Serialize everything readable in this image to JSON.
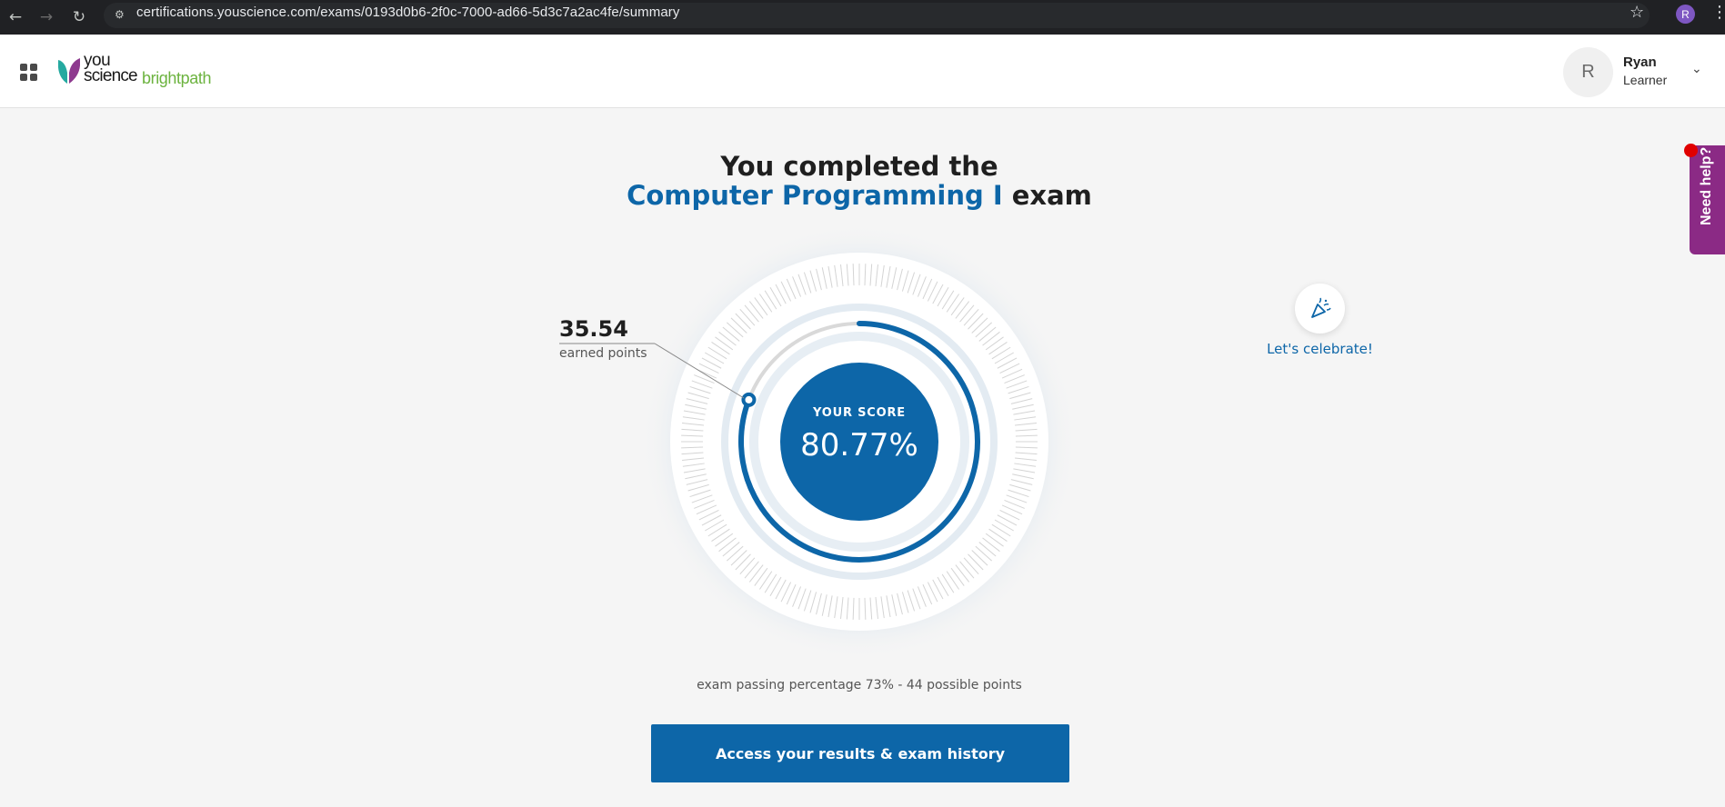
{
  "browser": {
    "url": "certifications.youscience.com/exams/0193d0b6-2f0c-7000-ad66-5d3c7a2ac4fe/summary",
    "back_icon": "back-arrow-icon",
    "forward_icon": "forward-arrow-icon",
    "reload_icon": "reload-icon",
    "profile_initial": "R"
  },
  "header": {
    "logo_you": "you",
    "logo_science": "science",
    "logo_brightpath": "brightpath",
    "user_initial": "R",
    "user_name": "Ryan",
    "user_role": "Learner"
  },
  "summary": {
    "title_line1": "You completed the",
    "exam_name": "Computer Programming I",
    "title_suffix": " exam",
    "earned_points": "35.54",
    "earned_label": "earned points",
    "score_label": "YOUR SCORE",
    "score_value": "80.77%",
    "score_fraction": 0.8077,
    "passing_note": "exam passing percentage 73% - 44 possible points",
    "celebrate_label": "Let's celebrate!",
    "results_button": "Access your results & exam history"
  },
  "help": {
    "label": "Need help?"
  },
  "colors": {
    "brand_blue": "#0d66a8",
    "brand_green": "#6cb33f",
    "help_purple": "#8b2a85"
  }
}
